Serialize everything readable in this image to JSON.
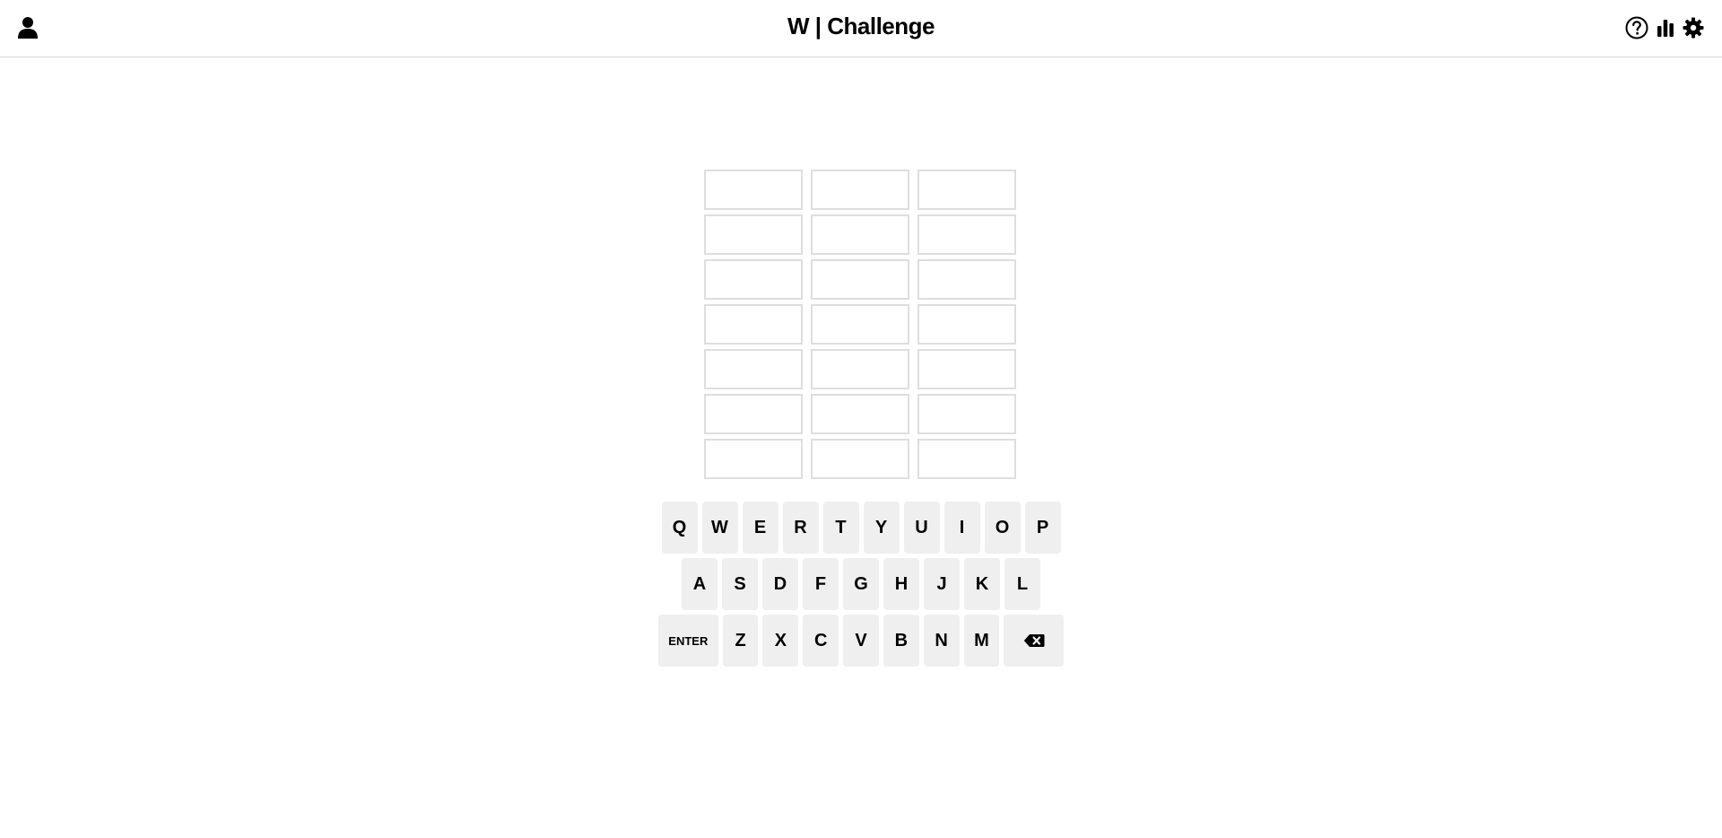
{
  "header": {
    "title": "W | Challenge",
    "icons": [
      "user-icon",
      "help-circle-icon",
      "bar-chart-icon",
      "gear-icon"
    ]
  },
  "board": {
    "rows": 7,
    "cols": 3,
    "tiles": [
      [
        "",
        "",
        ""
      ],
      [
        "",
        "",
        ""
      ],
      [
        "",
        "",
        ""
      ],
      [
        "",
        "",
        ""
      ],
      [
        "",
        "",
        ""
      ],
      [
        "",
        "",
        ""
      ],
      [
        "",
        "",
        ""
      ]
    ]
  },
  "keyboard": {
    "row1": [
      "Q",
      "W",
      "E",
      "R",
      "T",
      "Y",
      "U",
      "I",
      "O",
      "P"
    ],
    "row2": [
      "A",
      "S",
      "D",
      "F",
      "G",
      "H",
      "J",
      "K",
      "L"
    ],
    "row3": [
      "ENTER",
      "Z",
      "X",
      "C",
      "V",
      "B",
      "N",
      "M"
    ],
    "backspace_icon": "backspace-icon"
  },
  "colors": {
    "key_bg": "#efefef",
    "tile_border": "#dedede",
    "header_border": "#d9d9d9"
  }
}
